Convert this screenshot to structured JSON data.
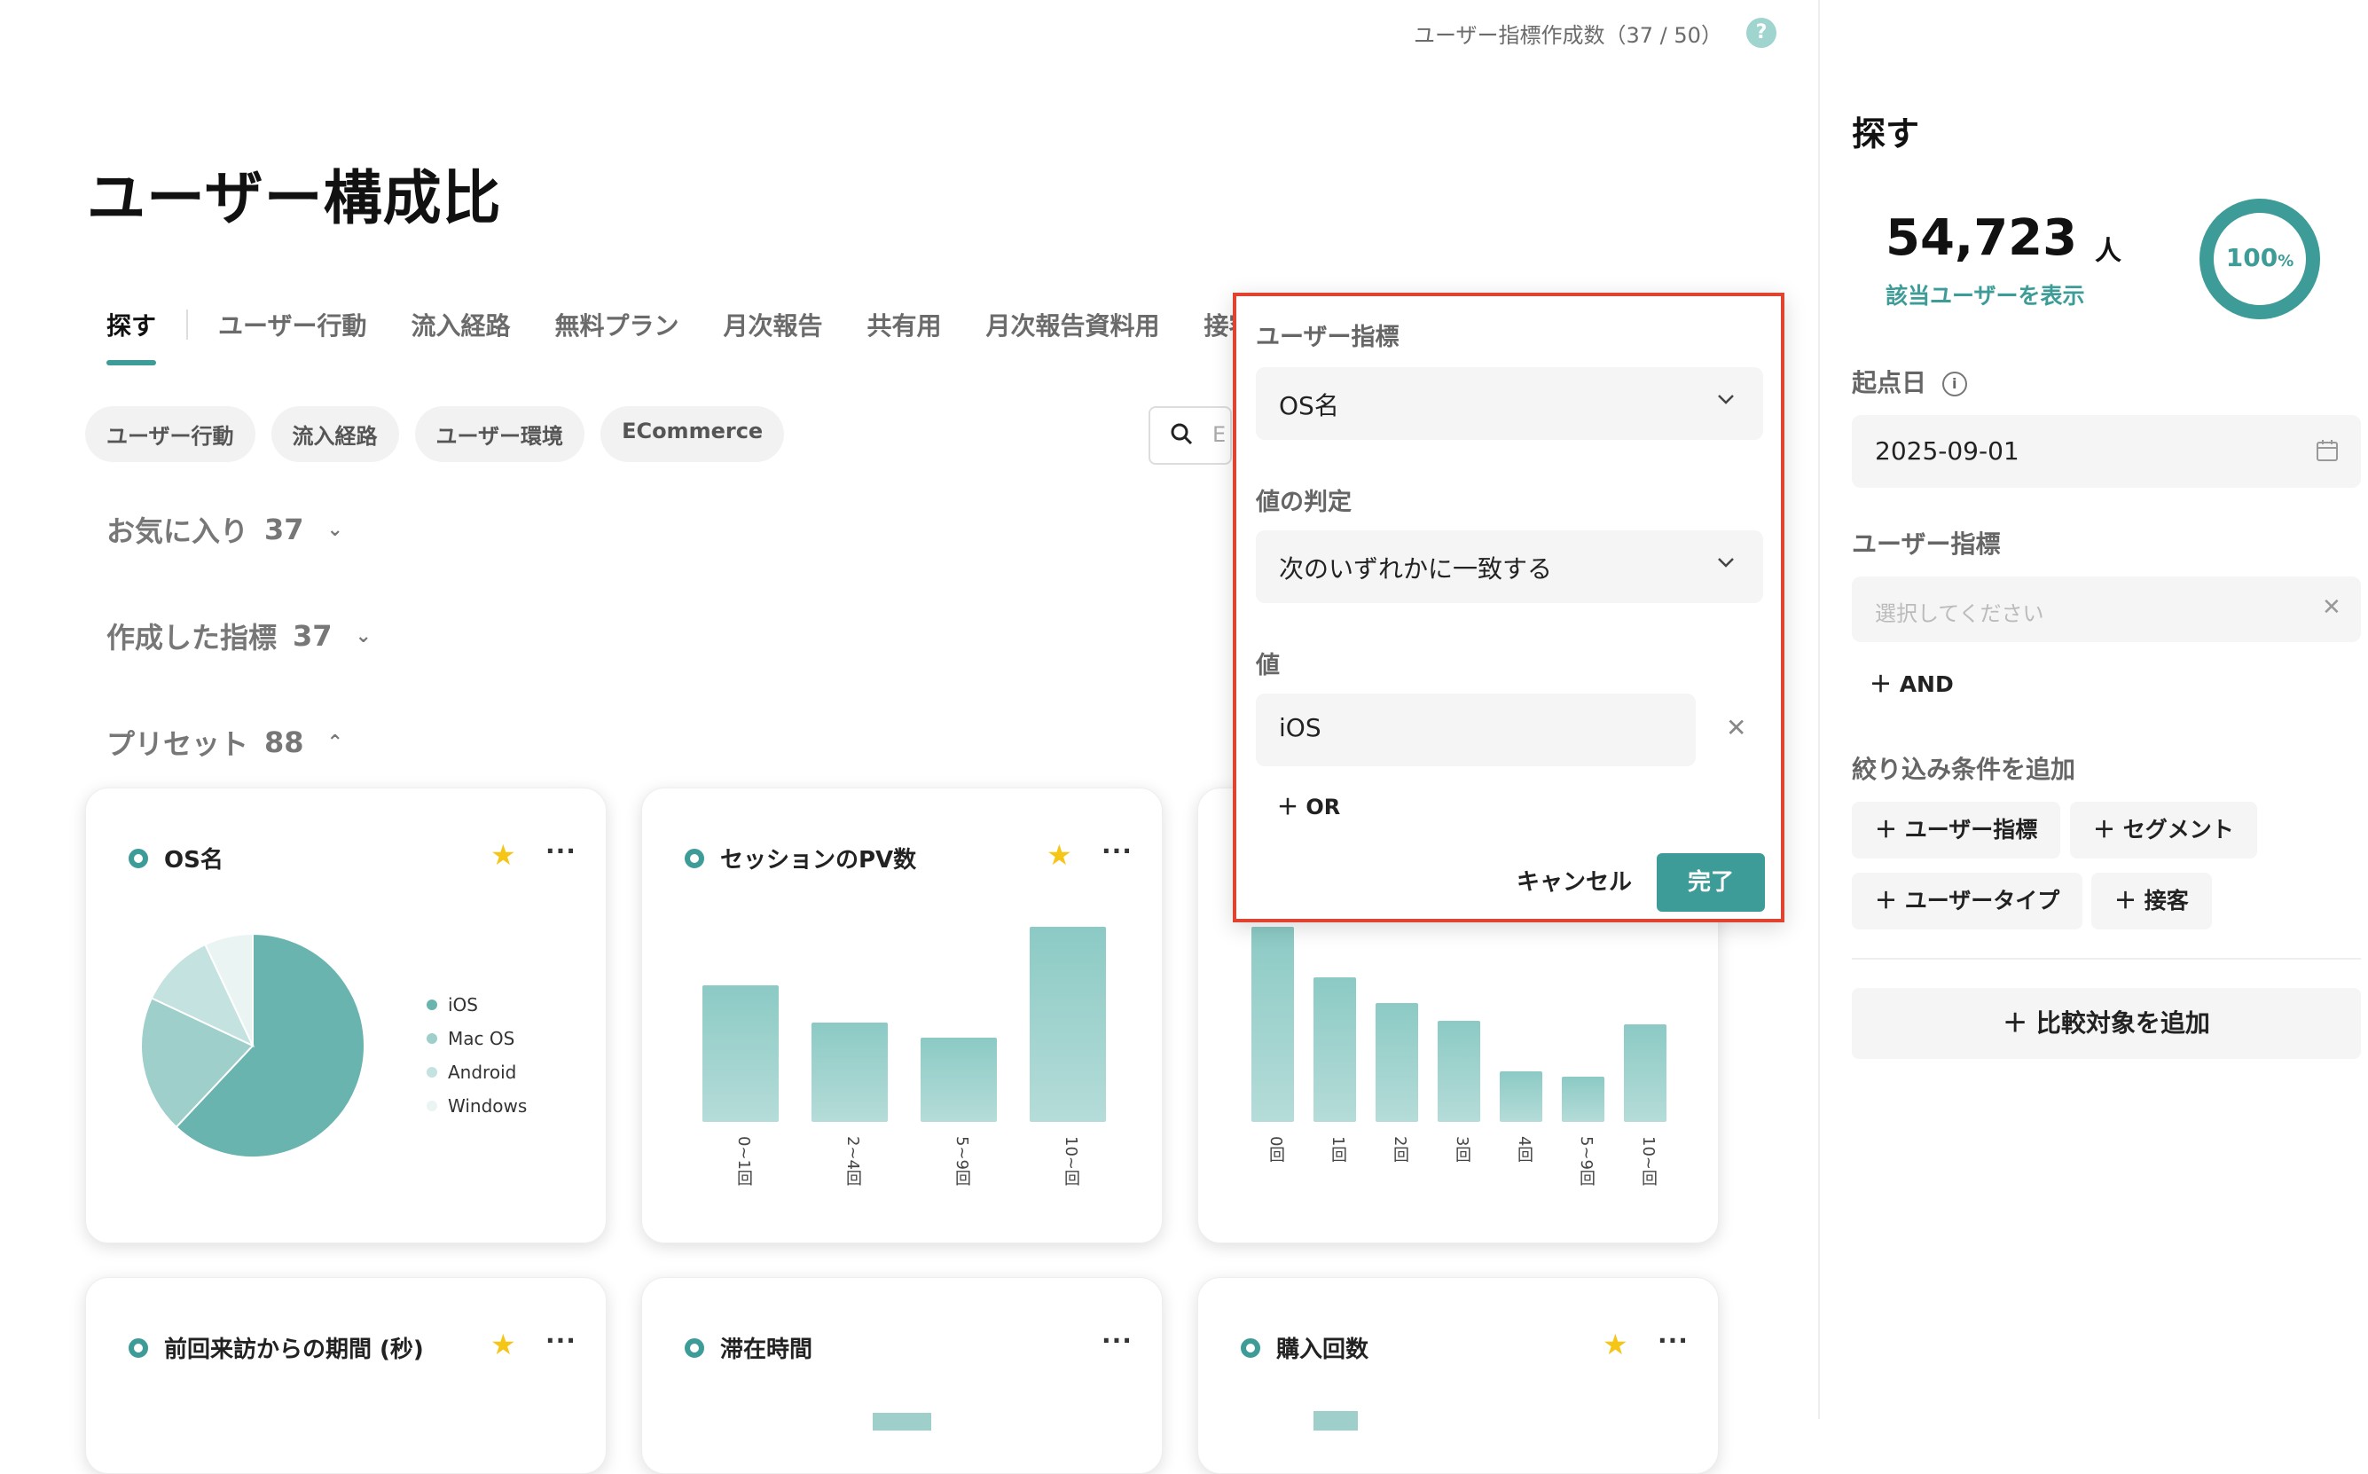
{
  "header": {
    "quota_text": "ユーザー指標作成数（37 / 50）",
    "help_symbol": "?",
    "page_title": "ユーザー構成比"
  },
  "tabs": [
    "探す",
    "ユーザー行動",
    "流入経路",
    "無料プラン",
    "月次報告",
    "共有用",
    "月次報告資料用",
    "接客"
  ],
  "chips": [
    "ユーザー行動",
    "流入経路",
    "ユーザー環境",
    "ECommerce"
  ],
  "search": {
    "placeholder": "E"
  },
  "sections": [
    {
      "label": "お気に入り",
      "count": "37",
      "chevron": "⌄"
    },
    {
      "label": "作成した指標",
      "count": "37",
      "chevron": "⌄"
    },
    {
      "label": "プリセット",
      "count": "88",
      "chevron": "⌃"
    }
  ],
  "cards": [
    {
      "title": "OS名",
      "starred": true
    },
    {
      "title": "セッションのPV数",
      "starred": true
    },
    {
      "title": "",
      "starred": false
    },
    {
      "title": "前回来訪からの期間 (秒)",
      "starred": true
    },
    {
      "title": "滞在時間",
      "starred": false
    },
    {
      "title": "購入回数",
      "starred": true
    }
  ],
  "chart_data": [
    {
      "type": "pie",
      "categories": [
        "iOS",
        "Mac OS",
        "Android",
        "Windows"
      ],
      "values": [
        62,
        20,
        11,
        7
      ],
      "colors": [
        "#6ab4b0",
        "#9fcfcb",
        "#c4e2df",
        "#e9f4f3"
      ]
    },
    {
      "type": "bar",
      "categories": [
        "0~1回",
        "2~4回",
        "5~9回",
        "10~回"
      ],
      "values": [
        70,
        51,
        43,
        100
      ],
      "ylim": [
        0,
        100
      ]
    },
    {
      "type": "bar",
      "categories": [
        "0回",
        "1回",
        "2回",
        "3回",
        "4回",
        "5~9回",
        "10~回"
      ],
      "values": [
        100,
        74,
        61,
        52,
        26,
        23,
        50
      ],
      "ylim": [
        0,
        100
      ]
    }
  ],
  "popup": {
    "metric_label": "ユーザー指標",
    "metric_value": "OS名",
    "judge_label": "値の判定",
    "judge_value": "次のいずれかに一致する",
    "value_label": "値",
    "value_input": "iOS",
    "or_label": "＋ OR",
    "cancel_label": "キャンセル",
    "done_label": "完了"
  },
  "panel": {
    "title": "探す",
    "user_count": "54,723",
    "user_unit": "人",
    "show_users_link": "該当ユーザーを表示",
    "percent": "100",
    "percent_unit": "%",
    "start_date_label": "起点日",
    "start_date_value": "2025-09-01",
    "metric_label": "ユーザー指標",
    "metric_placeholder": "選択してください",
    "and_label": "＋ AND",
    "filter_label": "絞り込み条件を追加",
    "filter_buttons": [
      "＋ ユーザー指標",
      "＋ セグメント",
      "＋ ユーザータイプ",
      "＋ 接客"
    ],
    "compare_label": "＋ 比較対象を追加"
  }
}
